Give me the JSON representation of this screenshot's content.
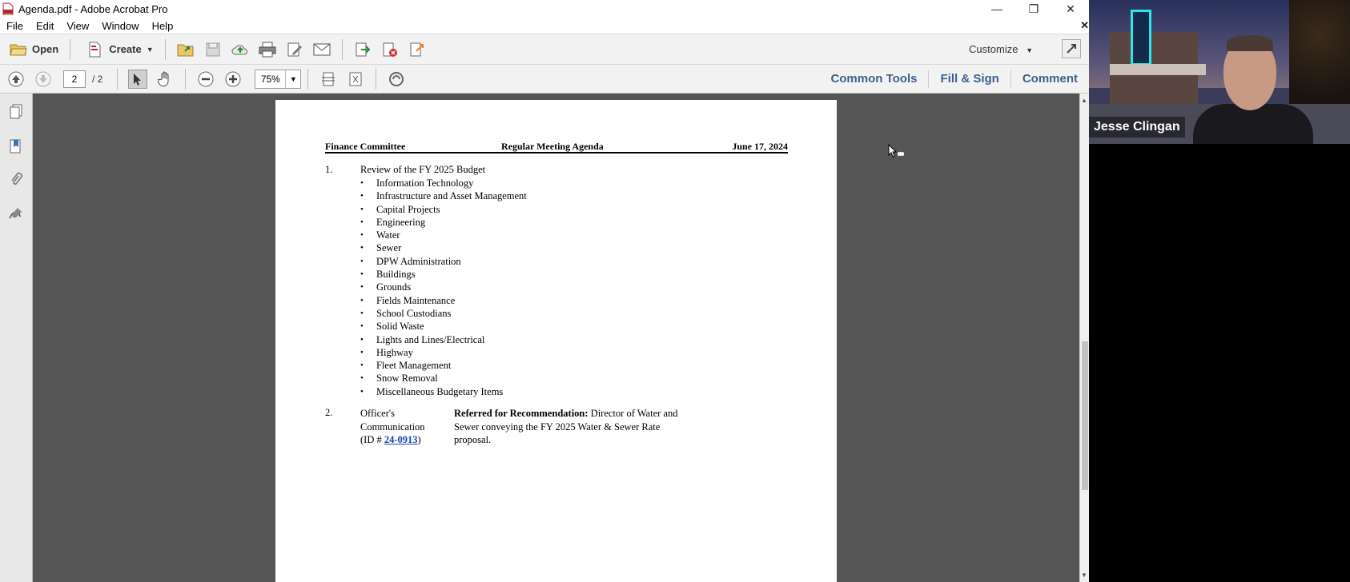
{
  "window": {
    "title": "Agenda.pdf - Adobe Acrobat Pro",
    "controls": {
      "minimize": "—",
      "restore": "❐",
      "close": "✕"
    }
  },
  "menu": [
    "File",
    "Edit",
    "View",
    "Window",
    "Help"
  ],
  "toolbar": {
    "open_label": "Open",
    "create_label": "Create",
    "customize_label": "Customize"
  },
  "navbar": {
    "current_page": "2",
    "total_pages": "/ 2",
    "zoom": "75%",
    "links": [
      "Common Tools",
      "Fill & Sign",
      "Comment"
    ]
  },
  "document": {
    "header": {
      "left": "Finance Committee",
      "center": "Regular Meeting Agenda",
      "right": "June 17, 2024"
    },
    "item1": {
      "number": "1.",
      "title": "Review of the FY 2025 Budget",
      "bullets": [
        "Information Technology",
        "Infrastructure and Asset Management",
        "Capital Projects",
        "Engineering",
        "Water",
        "Sewer",
        "DPW Administration",
        "Buildings",
        "Grounds",
        "Fields Maintenance",
        "School Custodians",
        "Solid Waste",
        "Lights and Lines/Electrical",
        "Highway",
        "Fleet Management",
        "Snow Removal",
        "Miscellaneous Budgetary Items"
      ]
    },
    "item2": {
      "number": "2.",
      "left_line1": "Officer's",
      "left_line2": "Communication",
      "id_prefix": "(ID # ",
      "id_link": "24-0913",
      "id_suffix": ")",
      "referred_label": "Referred for Recommendation:",
      "desc_line1": " Director of Water and",
      "desc_line2": "Sewer conveying the FY 2025 Water & Sewer Rate",
      "desc_line3": "proposal."
    }
  },
  "video": {
    "participant_name": "Jesse Clingan"
  }
}
